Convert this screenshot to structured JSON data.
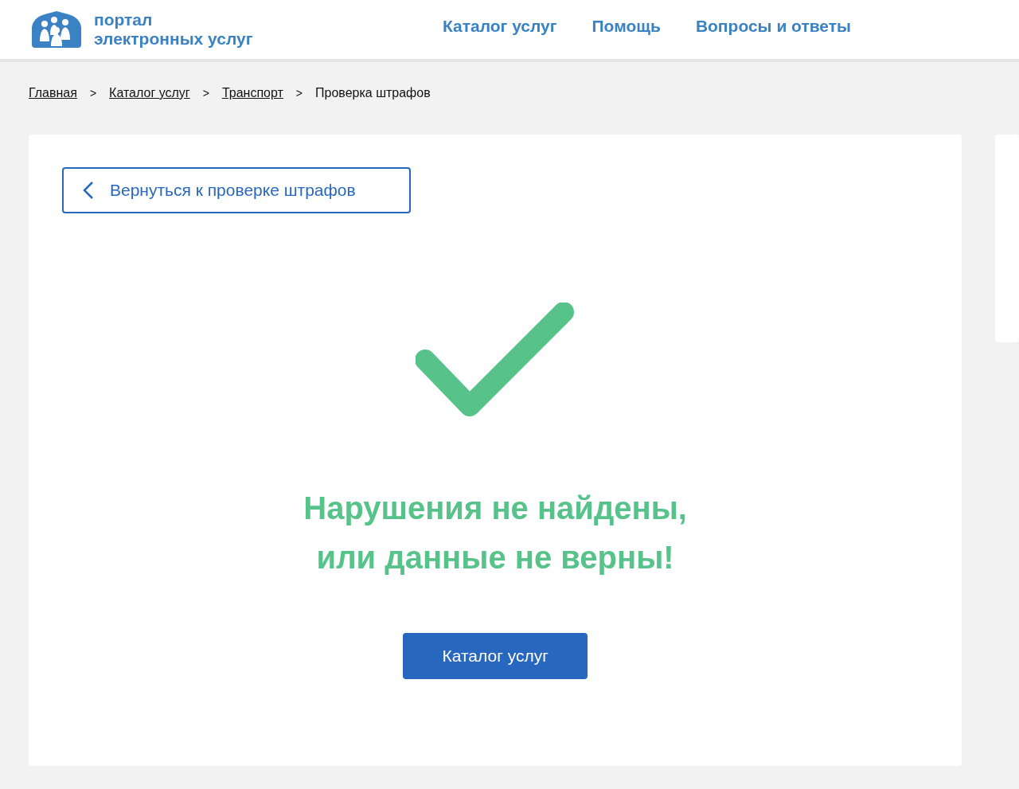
{
  "logo": {
    "line_1": "портал",
    "line_2": "электронных услуг"
  },
  "nav": [
    "Каталог услуг",
    "Помощь",
    "Вопросы и ответы"
  ],
  "breadcrumbs": [
    {
      "label": "Главная",
      "kind": "link"
    },
    {
      "label": ">",
      "kind": "separator"
    },
    {
      "label": "Каталог услуг",
      "kind": "link"
    },
    {
      "label": ">",
      "kind": "separator"
    },
    {
      "label": "Транспорт",
      "kind": "link"
    },
    {
      "label": ">",
      "kind": "separator"
    },
    {
      "label": "Проверка штрафов",
      "kind": "current"
    }
  ],
  "back_button": "Вернуться к проверке штрафов",
  "result": {
    "line_1": "Нарушения не найдены,",
    "line_2": "или данные не верны!"
  },
  "catalog_button": "Каталог услуг"
}
